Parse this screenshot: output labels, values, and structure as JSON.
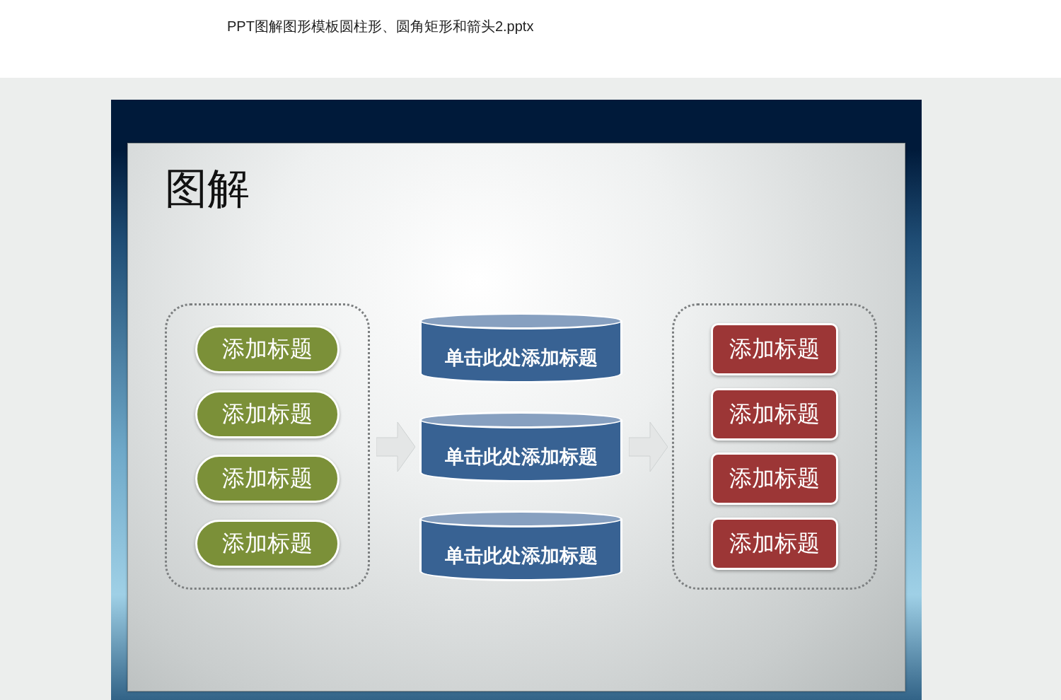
{
  "document": {
    "filename": "PPT图解图形模板圆柱形、圆角矩形和箭头2.pptx"
  },
  "slide": {
    "title": "图解",
    "left_items": [
      "添加标题",
      "添加标题",
      "添加标题",
      "添加标题"
    ],
    "center_items": [
      "单击此处添加标题",
      "单击此处添加标题",
      "单击此处添加标题"
    ],
    "right_items": [
      "添加标题",
      "添加标题",
      "添加标题",
      "添加标题"
    ]
  }
}
